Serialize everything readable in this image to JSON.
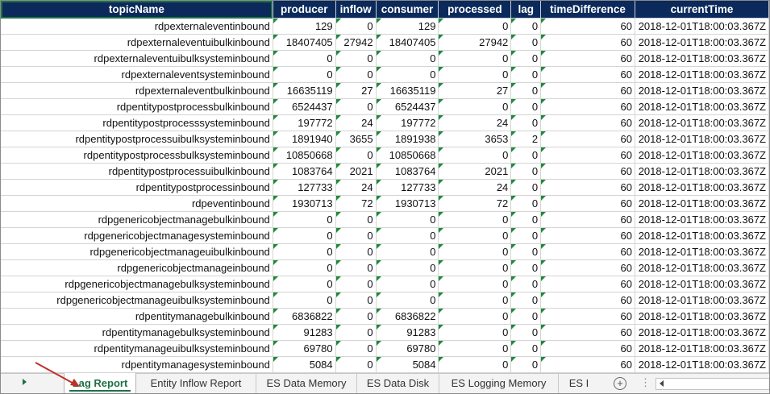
{
  "sheet": {
    "columns": [
      "topicName",
      "producer",
      "inflow",
      "consumer",
      "processed",
      "lag",
      "timeDifference",
      "currentTime"
    ],
    "rows": [
      [
        "rdpexternaleventinbound",
        "129",
        "0",
        "129",
        "0",
        "0",
        "60",
        "2018-12-01T18:00:03.367Z"
      ],
      [
        "rdpexternaleventuibulkinbound",
        "18407405",
        "27942",
        "18407405",
        "27942",
        "0",
        "60",
        "2018-12-01T18:00:03.367Z"
      ],
      [
        "rdpexternaleventuibulksysteminbound",
        "0",
        "0",
        "0",
        "0",
        "0",
        "60",
        "2018-12-01T18:00:03.367Z"
      ],
      [
        "rdpexternaleventsysteminbound",
        "0",
        "0",
        "0",
        "0",
        "0",
        "60",
        "2018-12-01T18:00:03.367Z"
      ],
      [
        "rdpexternaleventbulkinbound",
        "16635119",
        "27",
        "16635119",
        "27",
        "0",
        "60",
        "2018-12-01T18:00:03.367Z"
      ],
      [
        "rdpentitypostprocessbulkinbound",
        "6524437",
        "0",
        "6524437",
        "0",
        "0",
        "60",
        "2018-12-01T18:00:03.367Z"
      ],
      [
        "rdpentitypostprocesssysteminbound",
        "197772",
        "24",
        "197772",
        "24",
        "0",
        "60",
        "2018-12-01T18:00:03.367Z"
      ],
      [
        "rdpentitypostprocessuibulksysteminbound",
        "1891940",
        "3655",
        "1891938",
        "3653",
        "2",
        "60",
        "2018-12-01T18:00:03.367Z"
      ],
      [
        "rdpentitypostprocessbulksysteminbound",
        "10850668",
        "0",
        "10850668",
        "0",
        "0",
        "60",
        "2018-12-01T18:00:03.367Z"
      ],
      [
        "rdpentitypostprocessuibulkinbound",
        "1083764",
        "2021",
        "1083764",
        "2021",
        "0",
        "60",
        "2018-12-01T18:00:03.367Z"
      ],
      [
        "rdpentitypostprocessinbound",
        "127733",
        "24",
        "127733",
        "24",
        "0",
        "60",
        "2018-12-01T18:00:03.367Z"
      ],
      [
        "rdpeventinbound",
        "1930713",
        "72",
        "1930713",
        "72",
        "0",
        "60",
        "2018-12-01T18:00:03.367Z"
      ],
      [
        "rdpgenericobjectmanagebulkinbound",
        "0",
        "0",
        "0",
        "0",
        "0",
        "60",
        "2018-12-01T18:00:03.367Z"
      ],
      [
        "rdpgenericobjectmanagesysteminbound",
        "0",
        "0",
        "0",
        "0",
        "0",
        "60",
        "2018-12-01T18:00:03.367Z"
      ],
      [
        "rdpgenericobjectmanageuibulkinbound",
        "0",
        "0",
        "0",
        "0",
        "0",
        "60",
        "2018-12-01T18:00:03.367Z"
      ],
      [
        "rdpgenericobjectmanageinbound",
        "0",
        "0",
        "0",
        "0",
        "0",
        "60",
        "2018-12-01T18:00:03.367Z"
      ],
      [
        "rdpgenericobjectmanagebulksysteminbound",
        "0",
        "0",
        "0",
        "0",
        "0",
        "60",
        "2018-12-01T18:00:03.367Z"
      ],
      [
        "rdpgenericobjectmanageuibulksysteminbound",
        "0",
        "0",
        "0",
        "0",
        "0",
        "60",
        "2018-12-01T18:00:03.367Z"
      ],
      [
        "rdpentitymanagebulkinbound",
        "6836822",
        "0",
        "6836822",
        "0",
        "0",
        "60",
        "2018-12-01T18:00:03.367Z"
      ],
      [
        "rdpentitymanagebulksysteminbound",
        "91283",
        "0",
        "91283",
        "0",
        "0",
        "60",
        "2018-12-01T18:00:03.367Z"
      ],
      [
        "rdpentitymanageuibulksysteminbound",
        "69780",
        "0",
        "69780",
        "0",
        "0",
        "60",
        "2018-12-01T18:00:03.367Z"
      ],
      [
        "rdpentitymanagesysteminbound",
        "5084",
        "0",
        "5084",
        "0",
        "0",
        "60",
        "2018-12-01T18:00:03.367Z"
      ]
    ]
  },
  "tabs": [
    "Lag Report",
    "Entity Inflow Report",
    "ES Data Memory",
    "ES Data Disk",
    "ES Logging Memory",
    "ES I"
  ],
  "active_tab": "Lag Report",
  "add_sheet_label": "+",
  "more_label": "⋮",
  "colors": {
    "header_bg": "#0b2a5b",
    "accent": "#1e7145",
    "annotation_arrow": "#c0302a"
  },
  "icons": [
    "sheet-nav-right-icon",
    "add-sheet-icon",
    "scroll-left-icon",
    "annotation-arrow-icon"
  ]
}
